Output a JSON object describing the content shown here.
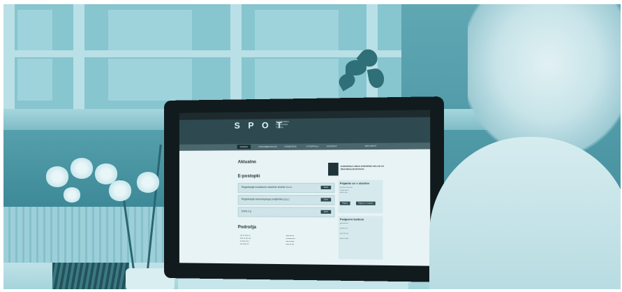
{
  "photo": {
    "description_tags": [
      "office-scene",
      "monitor",
      "person",
      "orchid",
      "window"
    ]
  },
  "screen": {
    "logo": "S P O T",
    "logo_sub": [
      "SLOVENSKA",
      "POSLOVNA",
      "TOČKA"
    ],
    "nav_tabs": [
      "DOMOV",
      "DOKUMENTACIJA",
      "PODROČJA",
      "O PORTALU",
      "KONTAKT",
      "MOJ SPOT"
    ],
    "aktualno": "Aktualno",
    "e_postopki": "E-postopki",
    "boxes": [
      {
        "label": "Registracija enostavne zasebne družbe d.o.o.",
        "button": "Začni"
      },
      {
        "label": "Registracija samostojnega podjetnika (s.p.)",
        "button": "Začni"
      },
      {
        "label": "Izbris s.p.",
        "button": "Začni"
      }
    ],
    "podrocja": "Področja",
    "eu_text": "EVROPSKA UNIJA EVROPSKI SKLAD ZA REGIONALNI RAZVOJ",
    "side_heading": "Prijavite se v storitev",
    "side_buttons": [
      "Prijava",
      "Prijava z e-kartico"
    ],
    "side_heading_2": "Podporni kotiček"
  }
}
